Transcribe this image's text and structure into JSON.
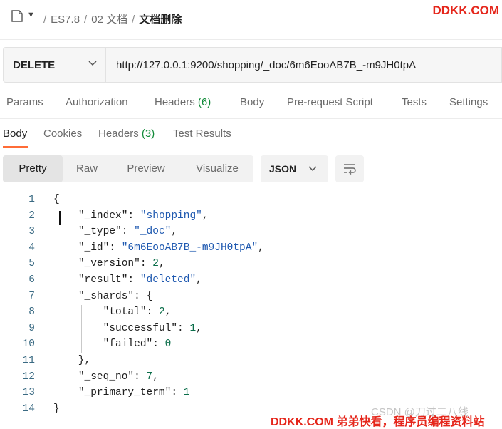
{
  "breadcrumb": {
    "items": [
      "ES7.8",
      "02 文档"
    ],
    "current": "文档删除"
  },
  "watermark_top": "DDKK.COM",
  "request": {
    "method": "DELETE",
    "url": "http://127.0.0.1:9200/shopping/_doc/6m6EooAB7B_-m9JH0tpA"
  },
  "request_tabs": {
    "params": "Params",
    "authorization": "Authorization",
    "headers": "Headers",
    "headers_count": "(6)",
    "body": "Body",
    "prerequest": "Pre-request Script",
    "tests": "Tests",
    "settings": "Settings"
  },
  "response_tabs": {
    "body": "Body",
    "cookies": "Cookies",
    "headers": "Headers",
    "headers_count": "(3)",
    "test_results": "Test Results"
  },
  "format_toolbar": {
    "pretty": "Pretty",
    "raw": "Raw",
    "preview": "Preview",
    "visualize": "Visualize",
    "selected_format": "JSON"
  },
  "code_lines": [
    "{",
    "    \"_index\": \"shopping\",",
    "    \"_type\": \"_doc\",",
    "    \"_id\": \"6m6EooAB7B_-m9JH0tpA\",",
    "    \"_version\": 2,",
    "    \"result\": \"deleted\",",
    "    \"_shards\": {",
    "        \"total\": 2,",
    "        \"successful\": 1,",
    "        \"failed\": 0",
    "    },",
    "    \"_seq_no\": 7,",
    "    \"_primary_term\": 1",
    "}"
  ],
  "line_numbers": [
    "1",
    "2",
    "3",
    "4",
    "5",
    "6",
    "7",
    "8",
    "9",
    "10",
    "11",
    "12",
    "13",
    "14"
  ],
  "watermark_csdn": "CSDN @刀过二八线",
  "watermark_bottom": "DDKK.COM 弟弟快看，程序员编程资料站",
  "colors": {
    "accent": "#ff6c37",
    "count_green": "#0f8a37",
    "string_blue": "#1f59b0",
    "number_green": "#0b6e4a",
    "watermark_red": "#e5261b"
  }
}
